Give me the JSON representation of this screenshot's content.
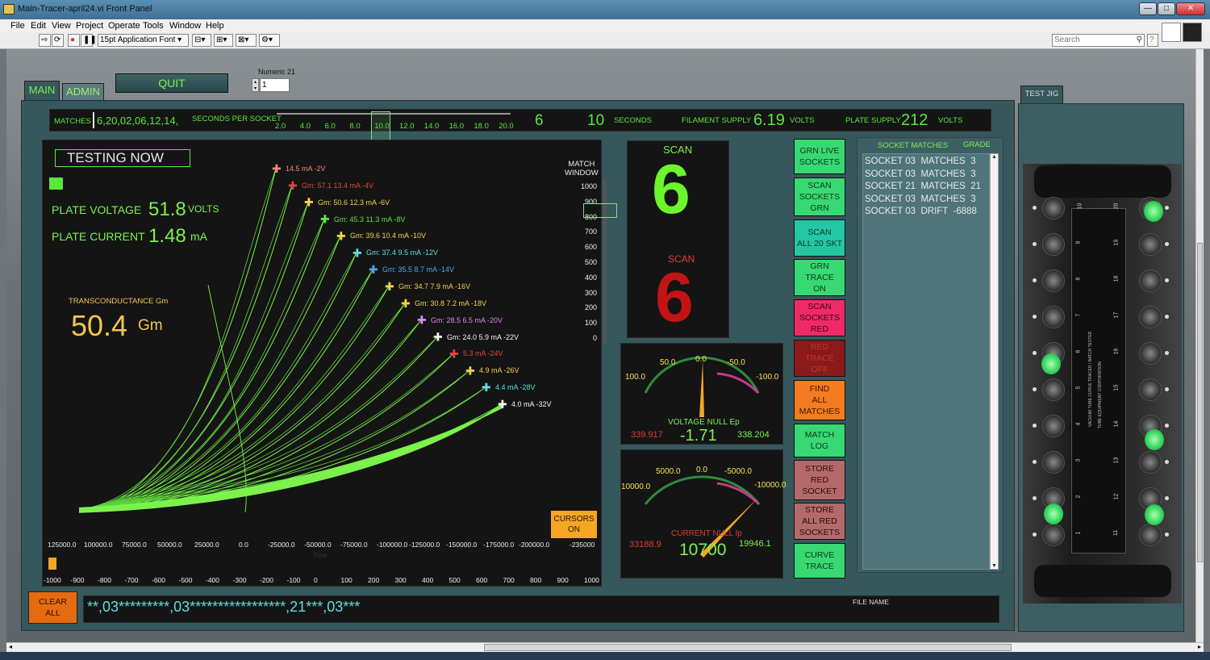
{
  "window": {
    "title": "Main-Tracer-april24.vi Front Panel",
    "min": "—",
    "max": "□",
    "close": "✕"
  },
  "menu": [
    "File",
    "Edit",
    "View",
    "Project",
    "Operate",
    "Tools",
    "Window",
    "Help"
  ],
  "toolbar": {
    "font_select": "15pt Application Font",
    "search_placeholder": "Search"
  },
  "tabs": {
    "main": "MAIN",
    "admin": "ADMIN",
    "test_jig": "TEST JIG"
  },
  "quit_label": "QUIT",
  "numeric": {
    "label": "Numeric 21",
    "value": "1"
  },
  "status_bar": {
    "matches_label": "MATCHES",
    "matches_value": "6,20,02,06,12,14,",
    "seconds_label": "SECONDS PER SOCKET",
    "slider_ticks": [
      "2.0",
      "4.0",
      "6.0",
      "8.0",
      "10.0",
      "12.0",
      "14.0",
      "16.0",
      "18.0",
      "20.0"
    ],
    "slider_value": 10,
    "current_socket": "6",
    "seconds_value": "10",
    "seconds_unit": "SECONDS",
    "filament_label": "FILAMENT SUPPLY",
    "filament_value": "6.19",
    "filament_unit": "VOLTS",
    "plate_label": "PLATE SUPPLY",
    "plate_value": "212",
    "plate_unit": "VOLTS"
  },
  "graph": {
    "testing": "TESTING NOW",
    "plate_voltage_label": "PLATE VOLTAGE",
    "plate_voltage_value": "51.8",
    "plate_voltage_unit": "VOLTS",
    "plate_current_label": "PLATE CURRENT",
    "plate_current_value": "1.48",
    "plate_current_unit": "mA",
    "gm_label": "TRANSCONDUCTANCE Gm",
    "gm_value": "50.4",
    "gm_unit": "Gm",
    "match_window_label": "MATCH\nWINDOW",
    "match_ticks": [
      "1000",
      "900",
      "800",
      "700",
      "600",
      "500",
      "400",
      "300",
      "200",
      "100",
      "0"
    ],
    "cursors_label": "CURSORS\nON",
    "time_label": "Time",
    "x_ticks": [
      "125000.0",
      "100000.0",
      "75000.0",
      "50000.0",
      "25000.0",
      "0.0",
      "-25000.0",
      "-50000.0",
      "-75000.0",
      "-100000.0",
      "-125000.0",
      "-150000.0",
      "-175000.0",
      "-200000.0",
      "-235000"
    ],
    "bottom_ticks": [
      "-1000",
      "-900",
      "-800",
      "-700",
      "-600",
      "-500",
      "-400",
      "-300",
      "-200",
      "-100",
      "0",
      "100",
      "200",
      "300",
      "400",
      "500",
      "600",
      "700",
      "800",
      "900",
      "1000"
    ]
  },
  "chart_data": {
    "type": "line",
    "series": [
      {
        "label": "14.5  mA  -2V",
        "color": "#f08a7a"
      },
      {
        "label": "Gm: 57.1  13.4 mA -4V",
        "color": "#e2453a"
      },
      {
        "label": "Gm: 50.6  12.3 mA -6V",
        "color": "#f5d34c"
      },
      {
        "label": "Gm: 45.3  11.3 mA -8V",
        "color": "#59e93a"
      },
      {
        "label": "Gm: 39.6  10.4  mA  -10V",
        "color": "#f5d34c"
      },
      {
        "label": "Gm: 37.4   9.5  mA  -12V",
        "color": "#5fe0e0"
      },
      {
        "label": "Gm: 35.5   8.7  mA  -14V",
        "color": "#4aa8f0"
      },
      {
        "label": "Gm: 34.7   7.9  mA  -16V",
        "color": "#f5d34c"
      },
      {
        "label": "Gm: 30.8   7.2  mA  -18V",
        "color": "#f5d34c"
      },
      {
        "label": "Gm: 28.5  6.5  mA  -20V",
        "color": "#d68af0"
      },
      {
        "label": "Gm: 24.0 5.9  mA  -22V",
        "color": "#f5f5f5"
      },
      {
        "label": "5.3  mA  -24V",
        "color": "#e2453a"
      },
      {
        "label": "4.9  mA  -26V",
        "color": "#f5d34c"
      },
      {
        "label": "4.4  mA  -28V",
        "color": "#5fe0e0"
      },
      {
        "label": "4.0  mA  -32V",
        "color": "#f5f5f5"
      }
    ]
  },
  "scan": {
    "label_top": "SCAN",
    "value_top": "6",
    "label_bottom": "SCAN",
    "value_bottom": "6"
  },
  "voltage_meter": {
    "scale": [
      "100.0",
      "50.0",
      "0.0",
      "-50.0",
      "-100.0"
    ],
    "label": "VOLTAGE NULL Ep",
    "left": "339.917",
    "value": "-1.71",
    "right": "338.204",
    "needle": -1.71
  },
  "current_meter": {
    "scale": [
      "10000.0",
      "5000.0",
      "0.0",
      "-5000.0",
      "-10000.0"
    ],
    "label": "CURRENT NULL Ip",
    "left": "33188.9",
    "value": "10700",
    "right": "19946.1",
    "needle": -8000
  },
  "buttons": [
    {
      "label": "GRN LIVE\nSOCKETS",
      "bg": "#38d873",
      "fg": "#0b3a1a"
    },
    {
      "label": "SCAN\nSOCKETS\nGRN",
      "bg": "#38d873",
      "fg": "#0b3a1a"
    },
    {
      "label": "SCAN\nALL 20 SKT",
      "bg": "#23c7a4",
      "fg": "#0b3a2a"
    },
    {
      "label": "GRN\nTRACE\nON",
      "bg": "#38d873",
      "fg": "#0b3a1a"
    },
    {
      "label": "SCAN\nSOCKETS\nRED",
      "bg": "#ef2a6a",
      "fg": "#3a0a18"
    },
    {
      "label": "RED\nTRACE\nOFF",
      "bg": "#8a1a1a",
      "fg": "#c23a2a"
    },
    {
      "label": "FIND\nALL\nMATCHES",
      "bg": "#f47c20",
      "fg": "#3a1800"
    },
    {
      "label": "MATCH\nLOG",
      "bg": "#38d873",
      "fg": "#0b3a1a"
    },
    {
      "label": "STORE\nRED\nSOCKET",
      "bg": "#b46a6a",
      "fg": "#2a0a0a"
    },
    {
      "label": "STORE\nALL RED\nSOCKETS",
      "bg": "#b46a6a",
      "fg": "#2a0a0a"
    },
    {
      "label": "CURVE\nTRACE",
      "bg": "#38d873",
      "fg": "#0b3a1a"
    }
  ],
  "socket_matches": {
    "header": "SOCKET MATCHES",
    "grade": "GRADE",
    "items": [
      "SOCKET 03  MATCHES  3",
      "SOCKET 03  MATCHES  3",
      "SOCKET 21  MATCHES  21",
      "SOCKET 03  MATCHES  3",
      "SOCKET 03  DRIFT  -6888"
    ]
  },
  "clear_all": "CLEAR\nALL",
  "sequence": "**,03*********,03*****************,21***,03***",
  "file_name_label": "FILE NAME",
  "jig_labels": [
    "VACUUM  TUBE CURVE TRACER",
    "/ BATCH TESTER",
    "TUBE EQUIPMENT CORPORATION"
  ],
  "jig_numbers_left": [
    "10",
    "9",
    "8",
    "7",
    "6",
    "5",
    "4",
    "3",
    "2",
    "1"
  ],
  "jig_numbers_right": [
    "20",
    "19",
    "18",
    "17",
    "16",
    "15",
    "14",
    "13",
    "12",
    "11"
  ]
}
